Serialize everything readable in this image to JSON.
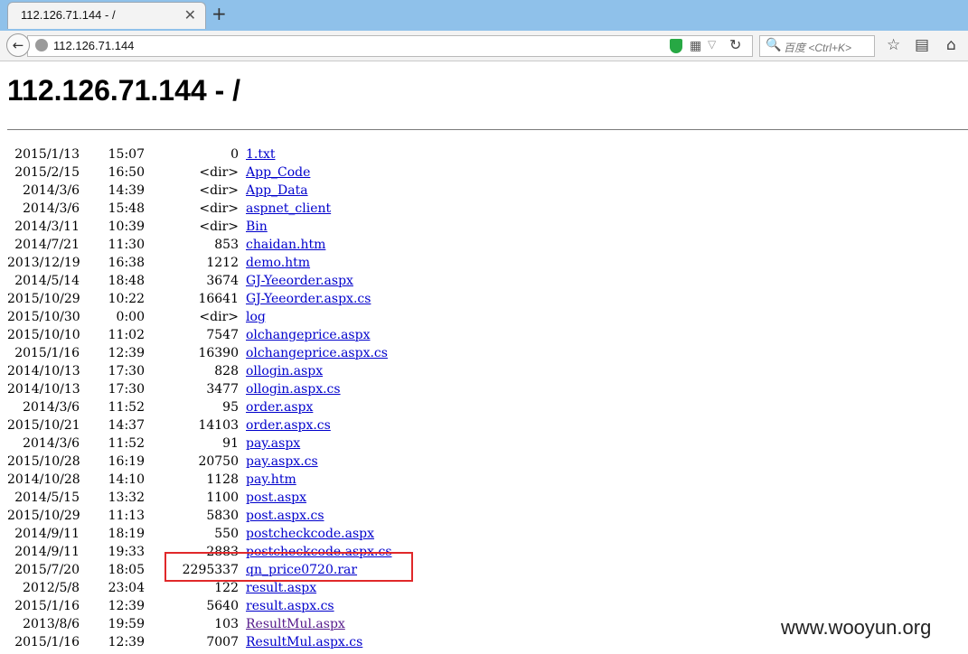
{
  "browser": {
    "tab_title": "112.126.71.144 - /",
    "tab_close": "✕",
    "new_tab": "+",
    "back_glyph": "←",
    "url": "112.126.71.144",
    "search_placeholder": "百度 <Ctrl+K>",
    "qr_glyph": "▦",
    "dropdown_glyph": "▽",
    "reload_glyph": "↻",
    "search_glyph": "🔍",
    "bookmark_glyph": "☆",
    "reader_glyph": "▤",
    "home_glyph": "⌂"
  },
  "page": {
    "title": "112.126.71.144 - /",
    "watermark": "www.wooyun.org",
    "link_color": "#0000cc",
    "visited_color": "#551a8b",
    "highlight_color": "#e0282a",
    "entries": [
      {
        "date": "2015/1/13",
        "time": "15:07",
        "size": "0",
        "name": "1.txt"
      },
      {
        "date": "2015/2/15",
        "time": "16:50",
        "size": "<dir>",
        "name": "App_Code"
      },
      {
        "date": "2014/3/6",
        "time": "14:39",
        "size": "<dir>",
        "name": "App_Data"
      },
      {
        "date": "2014/3/6",
        "time": "15:48",
        "size": "<dir>",
        "name": "aspnet_client"
      },
      {
        "date": "2014/3/11",
        "time": "10:39",
        "size": "<dir>",
        "name": "Bin"
      },
      {
        "date": "2014/7/21",
        "time": "11:30",
        "size": "853",
        "name": "chaidan.htm"
      },
      {
        "date": "2013/12/19",
        "time": "16:38",
        "size": "1212",
        "name": "demo.htm"
      },
      {
        "date": "2014/5/14",
        "time": "18:48",
        "size": "3674",
        "name": "GJ-Yeeorder.aspx"
      },
      {
        "date": "2015/10/29",
        "time": "10:22",
        "size": "16641",
        "name": "GJ-Yeeorder.aspx.cs"
      },
      {
        "date": "2015/10/30",
        "time": "0:00",
        "size": "<dir>",
        "name": "log"
      },
      {
        "date": "2015/10/10",
        "time": "11:02",
        "size": "7547",
        "name": "olchangeprice.aspx"
      },
      {
        "date": "2015/1/16",
        "time": "12:39",
        "size": "16390",
        "name": "olchangeprice.aspx.cs"
      },
      {
        "date": "2014/10/13",
        "time": "17:30",
        "size": "828",
        "name": "ollogin.aspx"
      },
      {
        "date": "2014/10/13",
        "time": "17:30",
        "size": "3477",
        "name": "ollogin.aspx.cs"
      },
      {
        "date": "2014/3/6",
        "time": "11:52",
        "size": "95",
        "name": "order.aspx"
      },
      {
        "date": "2015/10/21",
        "time": "14:37",
        "size": "14103",
        "name": "order.aspx.cs"
      },
      {
        "date": "2014/3/6",
        "time": "11:52",
        "size": "91",
        "name": "pay.aspx"
      },
      {
        "date": "2015/10/28",
        "time": "16:19",
        "size": "20750",
        "name": "pay.aspx.cs"
      },
      {
        "date": "2014/10/28",
        "time": "14:10",
        "size": "1128",
        "name": "pay.htm"
      },
      {
        "date": "2014/5/15",
        "time": "13:32",
        "size": "1100",
        "name": "post.aspx"
      },
      {
        "date": "2015/10/29",
        "time": "11:13",
        "size": "5830",
        "name": "post.aspx.cs"
      },
      {
        "date": "2014/9/11",
        "time": "18:19",
        "size": "550",
        "name": "postcheckcode.aspx"
      },
      {
        "date": "2014/9/11",
        "time": "19:33",
        "size": "2883",
        "name": "postcheckcode.aspx.cs"
      },
      {
        "date": "2015/7/20",
        "time": "18:05",
        "size": "2295337",
        "name": "qn_price0720.rar"
      },
      {
        "date": "2012/5/8",
        "time": "23:04",
        "size": "122",
        "name": "result.aspx"
      },
      {
        "date": "2015/1/16",
        "time": "12:39",
        "size": "5640",
        "name": "result.aspx.cs"
      },
      {
        "date": "2013/8/6",
        "time": "19:59",
        "size": "103",
        "name": "ResultMul.aspx",
        "visited": true
      },
      {
        "date": "2015/1/16",
        "time": "12:39",
        "size": "7007",
        "name": "ResultMul.aspx.cs"
      }
    ]
  }
}
